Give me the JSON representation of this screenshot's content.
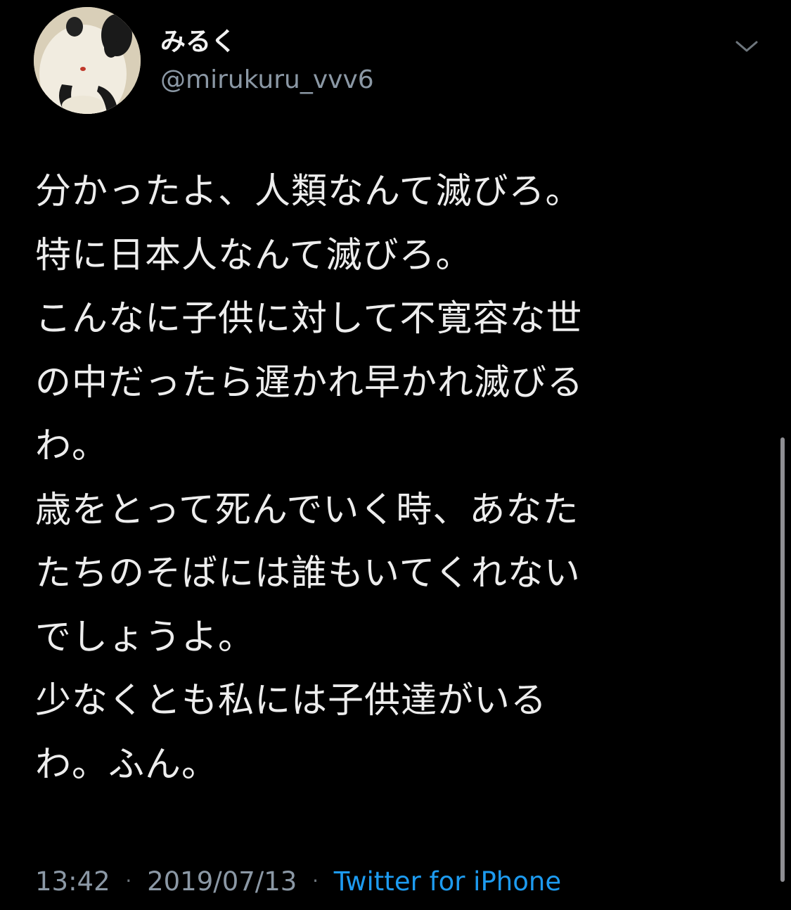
{
  "tweet": {
    "display_name": "みるく",
    "handle": "@mirukuru_vvv6",
    "body": "分かったよ、人類なんて滅びろ。\n特に日本人なんて滅びろ。\nこんなに子供に対して不寛容な世\nの中だったら遅かれ早かれ滅びる\nわ。\n歳をとって死んでいく時、あなた\nたちのそばには誰もいてくれない\nでしょうよ。\n少なくとも私には子供達がいる\nわ。ふん。",
    "time": "13:42",
    "separator": "·",
    "date": "2019/07/13",
    "source": "Twitter for iPhone"
  },
  "icons": {
    "avatar": "panda-plush-avatar",
    "menu": "chevron-down-icon"
  },
  "colors": {
    "background": "#000000",
    "text": "#ededed",
    "secondary": "#8b98a5",
    "link": "#1d9bf0"
  }
}
